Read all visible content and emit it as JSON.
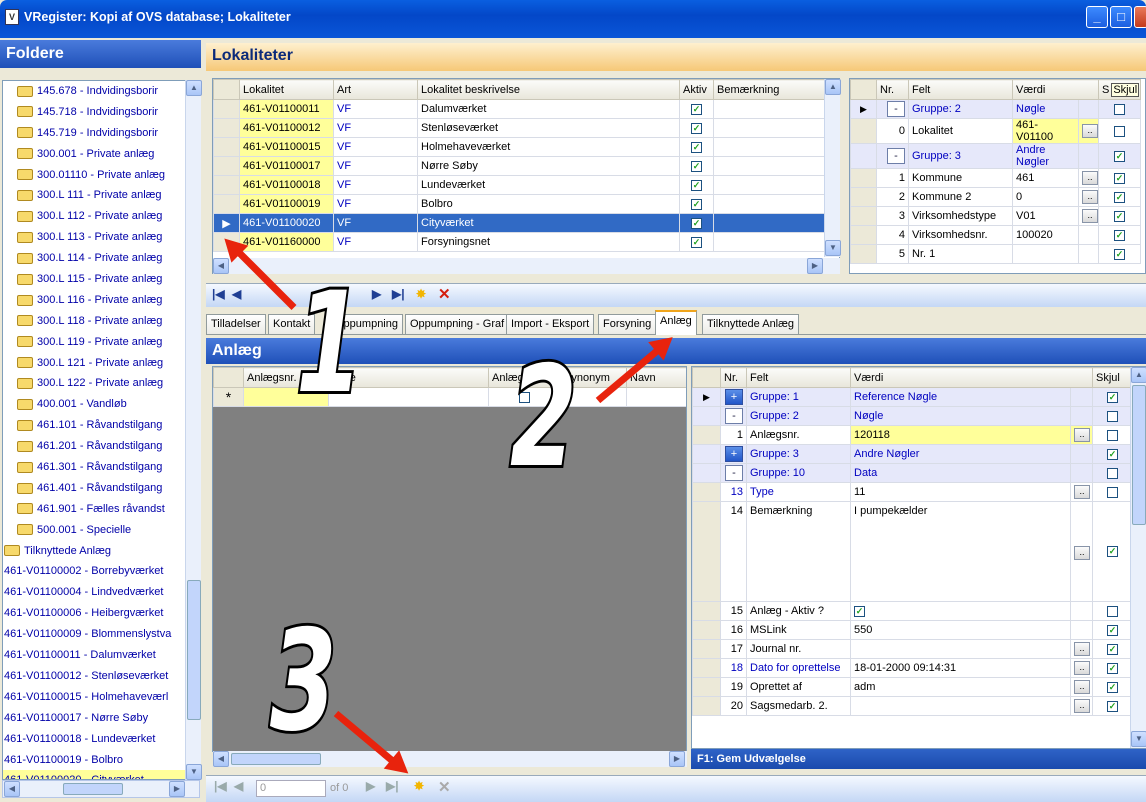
{
  "window": {
    "title": "VRegister: Kopi af OVS database; Lokaliteter",
    "min": "_",
    "max": "□",
    "close": "X"
  },
  "folders": {
    "header": "Foldere",
    "items": [
      {
        "label": "145.678 - Indvidingsborir",
        "icon": "folder"
      },
      {
        "label": "145.718 - Indvidingsborir",
        "icon": "folder"
      },
      {
        "label": "145.719 - Indvidingsborir",
        "icon": "folder"
      },
      {
        "label": "300.001 - Private anlæg",
        "icon": "folder"
      },
      {
        "label": "300.01110 - Private anlæg",
        "icon": "folder"
      },
      {
        "label": "300.L 111 - Private anlæg",
        "icon": "folder"
      },
      {
        "label": "300.L 112 - Private anlæg",
        "icon": "folder"
      },
      {
        "label": "300.L 113 - Private anlæg",
        "icon": "folder"
      },
      {
        "label": "300.L 114 - Private anlæg",
        "icon": "folder"
      },
      {
        "label": "300.L 115 - Private anlæg",
        "icon": "folder"
      },
      {
        "label": "300.L 116 - Private anlæg",
        "icon": "folder"
      },
      {
        "label": "300.L 118 - Private anlæg",
        "icon": "folder"
      },
      {
        "label": "300.L 119 - Private anlæg",
        "icon": "folder"
      },
      {
        "label": "300.L 121 - Private anlæg",
        "icon": "folder"
      },
      {
        "label": "300.L 122 - Private anlæg",
        "icon": "folder"
      },
      {
        "label": "400.001 - Vandløb",
        "icon": "folder"
      },
      {
        "label": "461.101 - Råvandstilgang",
        "icon": "folder"
      },
      {
        "label": "461.201 - Råvandstilgang",
        "icon": "folder"
      },
      {
        "label": "461.301 - Råvandstilgang",
        "icon": "folder"
      },
      {
        "label": "461.401 - Råvandstilgang",
        "icon": "folder"
      },
      {
        "label": "461.901 - Fælles råvandst",
        "icon": "folder"
      },
      {
        "label": "500.001 - Specielle",
        "icon": "folder"
      },
      {
        "label": "Tilknyttede Anlæg",
        "icon": "folder"
      },
      {
        "label": "461-V01100002 - Borrebyværket",
        "icon": ""
      },
      {
        "label": "461-V01100004 - Lindvedværket",
        "icon": ""
      },
      {
        "label": "461-V01100006 - Heibergværket",
        "icon": ""
      },
      {
        "label": "461-V01100009 - Blommenslystva",
        "icon": ""
      },
      {
        "label": "461-V01100011 - Dalumværket",
        "icon": ""
      },
      {
        "label": "461-V01100012 - Stenløseværket",
        "icon": ""
      },
      {
        "label": "461-V01100015 - Holmehaveværl",
        "icon": ""
      },
      {
        "label": "461-V01100017 - Nørre Søby",
        "icon": ""
      },
      {
        "label": "461-V01100018 - Lundeværket",
        "icon": ""
      },
      {
        "label": "461-V01100019 - Bolbro",
        "icon": ""
      },
      {
        "label": "461-V01100020 - Cityværket",
        "icon": "",
        "selected": true
      }
    ]
  },
  "lokaliteter": {
    "header": "Lokaliteter",
    "columns": [
      "Lokalitet",
      "Art",
      "Lokalitet beskrivelse",
      "Aktiv",
      "Bemærkning"
    ],
    "rows": [
      {
        "lok": "461-V01100011",
        "art": "VF",
        "besk": "Dalumværket",
        "aktiv": true
      },
      {
        "lok": "461-V01100012",
        "art": "VF",
        "besk": "Stenløseværket",
        "aktiv": true
      },
      {
        "lok": "461-V01100015",
        "art": "VF",
        "besk": "Holmehaveværket",
        "aktiv": true
      },
      {
        "lok": "461-V01100017",
        "art": "VF",
        "besk": "Nørre Søby",
        "aktiv": true
      },
      {
        "lok": "461-V01100018",
        "art": "VF",
        "besk": "Lundeværket",
        "aktiv": true
      },
      {
        "lok": "461-V01100019",
        "art": "VF",
        "besk": "Bolbro",
        "aktiv": true
      },
      {
        "lok": "461-V01100020",
        "art": "VF",
        "besk": "Cityværket",
        "aktiv": true,
        "selected": true
      },
      {
        "lok": "461-V01160000",
        "art": "VF",
        "besk": "Forsyningsnet",
        "aktiv": true
      }
    ]
  },
  "props_top": {
    "columns": [
      "Nr.",
      "Felt",
      "Værdi",
      "S"
    ],
    "tooltip": "Skjul",
    "rows": [
      {
        "nr": "",
        "felt": "Gruppe: 2",
        "vaerdi": "Nøgle",
        "grp": true,
        "btn": "-"
      },
      {
        "nr": "0",
        "felt": "Lokalitet",
        "vaerdi": "461-V01100",
        "lok": true,
        "dots": true
      },
      {
        "nr": "",
        "felt": "Gruppe: 3",
        "vaerdi": "Andre Nøgler",
        "grp": true,
        "btn": "-",
        "skjul": true
      },
      {
        "nr": "1",
        "felt": "Kommune",
        "vaerdi": "461",
        "dots": true,
        "skjul": true
      },
      {
        "nr": "2",
        "felt": "Kommune 2",
        "vaerdi": "0",
        "dots": true,
        "skjul": true
      },
      {
        "nr": "3",
        "felt": "Virksomhedstype",
        "vaerdi": "V01",
        "dots": true,
        "skjul": true
      },
      {
        "nr": "4",
        "felt": "Virksomhedsnr.",
        "vaerdi": "100020",
        "skjul": true
      },
      {
        "nr": "5",
        "felt": "Nr. 1",
        "vaerdi": "",
        "skjul": true
      }
    ]
  },
  "tabs": [
    "Tilladelser",
    "Kontakt",
    "Oppumpning",
    "Oppumpning - Graf",
    "Import - Eksport",
    "Forsyning",
    "Anlæg",
    "Tilknyttede Anlæg"
  ],
  "anlaeg": {
    "header": "Anlæg",
    "columns": [
      "Anlægsnr.",
      "Type",
      "Anlæg Aktiv",
      "Synonym",
      "Navn"
    ],
    "new_row_marker": "*"
  },
  "props_bottom": {
    "columns": [
      "Nr.",
      "Felt",
      "Værdi",
      "Skjul"
    ],
    "rows": [
      {
        "nr": "",
        "felt": "Gruppe: 1",
        "vaerdi": "Reference Nøgle",
        "grp": true,
        "btn": "+",
        "skjul": true
      },
      {
        "nr": "",
        "felt": "Gruppe: 2",
        "vaerdi": "Nøgle",
        "grp": true,
        "btn": "-"
      },
      {
        "nr": "1",
        "felt": "Anlægsnr.",
        "vaerdi": "120118",
        "lok": true,
        "dots": true
      },
      {
        "nr": "",
        "felt": "Gruppe: 3",
        "vaerdi": "Andre Nøgler",
        "grp": true,
        "btn": "+",
        "skjul": true
      },
      {
        "nr": "",
        "felt": "Gruppe: 10",
        "vaerdi": "Data",
        "grp": true,
        "btn": "-"
      },
      {
        "nr": "13",
        "felt": "Type",
        "vaerdi": "11",
        "dots": true,
        "link": true
      },
      {
        "nr": "14",
        "felt": "Bemærkning",
        "vaerdi": "I pumpekælder",
        "tall": true,
        "dots": true,
        "skjul": true
      },
      {
        "nr": "15",
        "felt": "Anlæg - Aktiv ?",
        "vaerdi": "",
        "cbval": true
      },
      {
        "nr": "16",
        "felt": "MSLink",
        "vaerdi": "550",
        "skjul": true
      },
      {
        "nr": "17",
        "felt": "Journal nr.",
        "vaerdi": "",
        "dots": true,
        "skjul": true
      },
      {
        "nr": "18",
        "felt": "Dato for oprettelse",
        "vaerdi": "18-01-2000 09:14:31",
        "dots": true,
        "skjul": true,
        "link": true
      },
      {
        "nr": "19",
        "felt": "Oprettet af",
        "vaerdi": "adm",
        "dots": true,
        "skjul": true
      },
      {
        "nr": "20",
        "felt": "Sagsmedarb. 2.",
        "vaerdi": "",
        "dots": true,
        "skjul": true
      }
    ]
  },
  "nav_bottom": {
    "pos": "0",
    "of": "of 0"
  },
  "status": "F1: Gem Udvælgelse",
  "annotations": [
    "1",
    "2",
    "3"
  ]
}
